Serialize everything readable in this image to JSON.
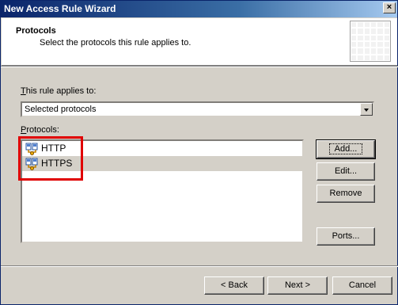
{
  "window": {
    "title": "New Access Rule Wizard",
    "close_label": "×"
  },
  "header": {
    "title": "Protocols",
    "subtitle": "Select the protocols this rule applies to."
  },
  "applies_to": {
    "label_accel": "T",
    "label_rest": "his rule applies to:",
    "selected_value": "Selected protocols"
  },
  "protocols": {
    "label_accel": "P",
    "label_rest": "rotocols:",
    "items": [
      {
        "label": "HTTP",
        "icon": "protocol-icon",
        "selected": false
      },
      {
        "label": "HTTPS",
        "icon": "protocol-icon",
        "selected": true
      }
    ]
  },
  "side_buttons": {
    "add": "Add...",
    "edit": "Edit...",
    "remove": "Remove",
    "ports": "Ports..."
  },
  "footer_buttons": {
    "back": "< Back",
    "next": "Next >",
    "cancel": "Cancel"
  },
  "colors": {
    "titlebar": "#0a246a",
    "dialog_bg": "#d4d0c8",
    "highlight_box": "#e00000"
  }
}
